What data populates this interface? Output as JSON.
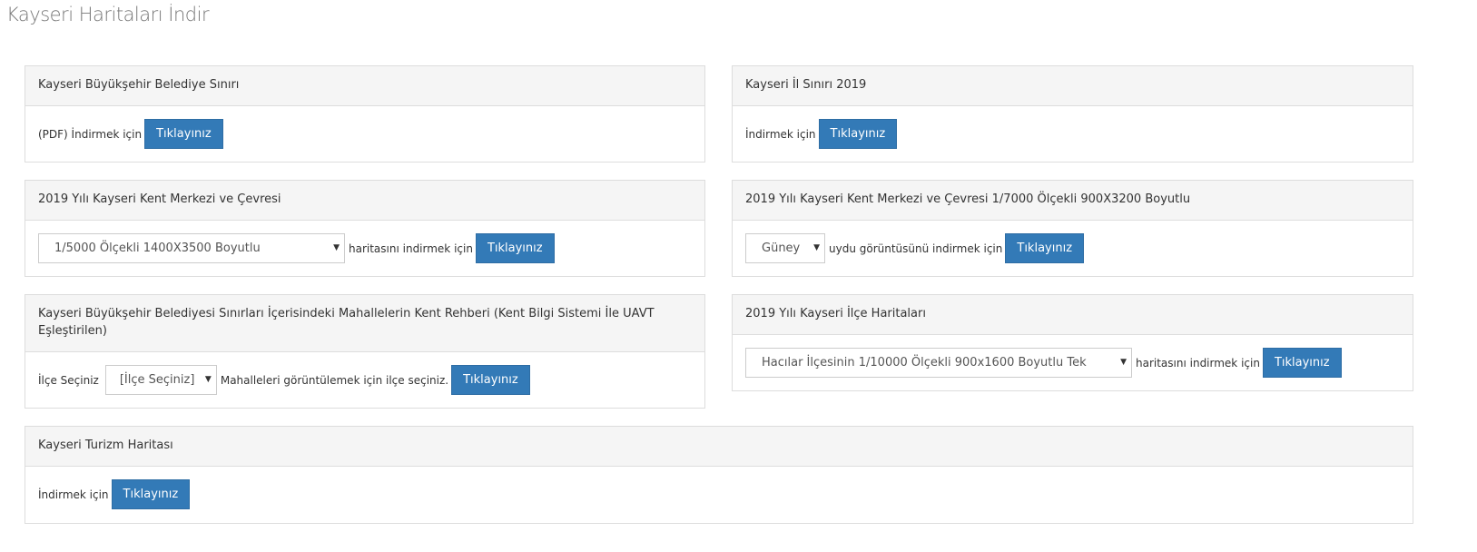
{
  "page": {
    "title": "Kayseri Haritaları İndir"
  },
  "panels": {
    "belediye_siniri": {
      "heading": "Kayseri Büyükşehir Belediye Sınırı",
      "label": "(PDF) İndirmek için",
      "button": "Tıklayınız"
    },
    "il_siniri": {
      "heading": "Kayseri İl Sınırı 2019",
      "label": "İndirmek için",
      "button": "Tıklayınız"
    },
    "kent_merkezi": {
      "heading": "2019 Yılı Kayseri Kent Merkezi ve Çevresi",
      "select_value": "1/5000 Ölçekli 1400X3500 Boyutlu",
      "label": "haritasını indirmek için",
      "button": "Tıklayınız"
    },
    "kent_merkezi_uydu": {
      "heading": "2019 Yılı Kayseri Kent Merkezi ve Çevresi 1/7000 Ölçekli 900X3200 Boyutlu",
      "select_value": "Güney",
      "label": "uydu görüntüsünü indirmek için",
      "button": "Tıklayınız"
    },
    "kent_rehberi": {
      "heading_line1": "Kayseri Büyükşehir Belediyesi Sınırları İçerisindeki Mahallelerin Kent Rehberi (Kent Bilgi Sistemi İle UAVT",
      "heading_line2": "Eşleştirilen)",
      "prefix_label": "İlçe Seçiniz",
      "select_value": "[İlçe Seçiniz]",
      "label": "Mahalleleri görüntülemek için ilçe seçiniz.",
      "button": "Tıklayınız"
    },
    "ilce_haritalari": {
      "heading": "2019 Yılı Kayseri İlçe Haritaları",
      "select_value": "Hacılar İlçesinin 1/10000 Ölçekli 900x1600 Boyutlu Tek",
      "label": "haritasını indirmek için",
      "button": "Tıklayınız"
    },
    "turizm": {
      "heading": "Kayseri Turizm Haritası",
      "label": "İndirmek için",
      "button": "Tıklayınız"
    }
  },
  "icons": {
    "select_caret": "▼"
  },
  "colors": {
    "primary_button": "#337ab7",
    "panel_heading_bg": "#f5f5f5",
    "panel_border": "#dddddd",
    "title_text": "#777777"
  }
}
